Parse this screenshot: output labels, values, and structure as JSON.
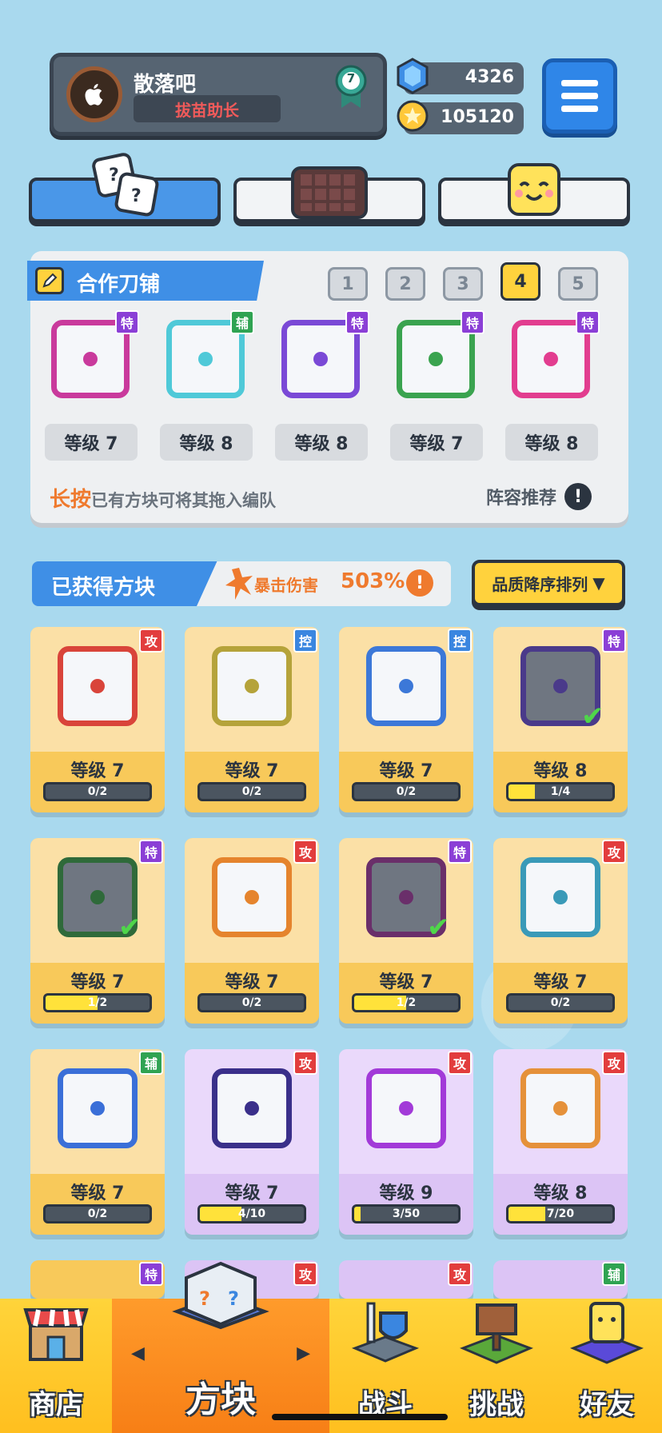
{
  "profile": {
    "name": "散落吧",
    "title": "拔苗助长",
    "rank": "7"
  },
  "currency": {
    "gems": "4326",
    "coins": "105120"
  },
  "team": {
    "title": "合作刀铺",
    "pages": [
      "1",
      "2",
      "3",
      "4",
      "5"
    ],
    "active_page": "4",
    "members": [
      {
        "tag": "特",
        "level": "等级 7",
        "color": "#c93a9c"
      },
      {
        "tag": "辅",
        "level": "等级 8",
        "color": "#4fc9d8"
      },
      {
        "tag": "特",
        "level": "等级 8",
        "color": "#7a49d6"
      },
      {
        "tag": "特",
        "level": "等级 7",
        "color": "#3aa34f"
      },
      {
        "tag": "特",
        "level": "等级 8",
        "color": "#e23d8f"
      }
    ],
    "hint_highlight": "长按",
    "hint_rest": "已有方块可将其拖入编队",
    "recommend": "阵容推荐"
  },
  "owned": {
    "title": "已获得方块",
    "crit_label": "暴击伤害",
    "crit_value": "503%",
    "sort_label": "品质降序排列"
  },
  "cards": [
    {
      "tag": "攻",
      "level": "等级 7",
      "progress": "0/2",
      "fill": 0,
      "rarity": "legend",
      "color": "#d9443a",
      "dark": false,
      "check": false
    },
    {
      "tag": "控",
      "level": "等级 7",
      "progress": "0/2",
      "fill": 0,
      "rarity": "legend",
      "color": "#b5a33a",
      "dark": false,
      "check": false
    },
    {
      "tag": "控",
      "level": "等级 7",
      "progress": "0/2",
      "fill": 0,
      "rarity": "legend",
      "color": "#3c78d8",
      "dark": false,
      "check": false
    },
    {
      "tag": "特",
      "level": "等级 8",
      "progress": "1/4",
      "fill": 0.25,
      "rarity": "legend",
      "color": "#4a3a8a",
      "dark": true,
      "check": true
    },
    {
      "tag": "特",
      "level": "等级 7",
      "progress": "1/2",
      "fill": 0.5,
      "rarity": "legend",
      "color": "#2f6a3a",
      "dark": true,
      "check": true
    },
    {
      "tag": "攻",
      "level": "等级 7",
      "progress": "0/2",
      "fill": 0,
      "rarity": "legend",
      "color": "#e5842d",
      "dark": false,
      "check": false
    },
    {
      "tag": "特",
      "level": "等级 7",
      "progress": "1/2",
      "fill": 0.5,
      "rarity": "legend",
      "color": "#6a2f6a",
      "dark": true,
      "check": true
    },
    {
      "tag": "攻",
      "level": "等级 7",
      "progress": "0/2",
      "fill": 0,
      "rarity": "legend",
      "color": "#3a9ab8",
      "dark": false,
      "check": false
    },
    {
      "tag": "辅",
      "level": "等级 7",
      "progress": "0/2",
      "fill": 0,
      "rarity": "legend",
      "color": "#3a6fd8",
      "dark": false,
      "check": false
    },
    {
      "tag": "攻",
      "level": "等级 7",
      "progress": "4/10",
      "fill": 0.4,
      "rarity": "epic",
      "color": "#3a2f8a",
      "dark": false,
      "check": false
    },
    {
      "tag": "攻",
      "level": "等级 9",
      "progress": "3/50",
      "fill": 0.06,
      "rarity": "epic",
      "color": "#a23ad8",
      "dark": false,
      "check": false
    },
    {
      "tag": "攻",
      "level": "等级 8",
      "progress": "7/20",
      "fill": 0.35,
      "rarity": "epic",
      "color": "#e5913a",
      "dark": false,
      "check": false
    }
  ],
  "partial_tags": [
    "特",
    "攻",
    "攻",
    "辅"
  ],
  "nav": {
    "shop": "商店",
    "blocks": "方块",
    "battle": "战斗",
    "challenge": "挑战",
    "friends": "好友"
  }
}
